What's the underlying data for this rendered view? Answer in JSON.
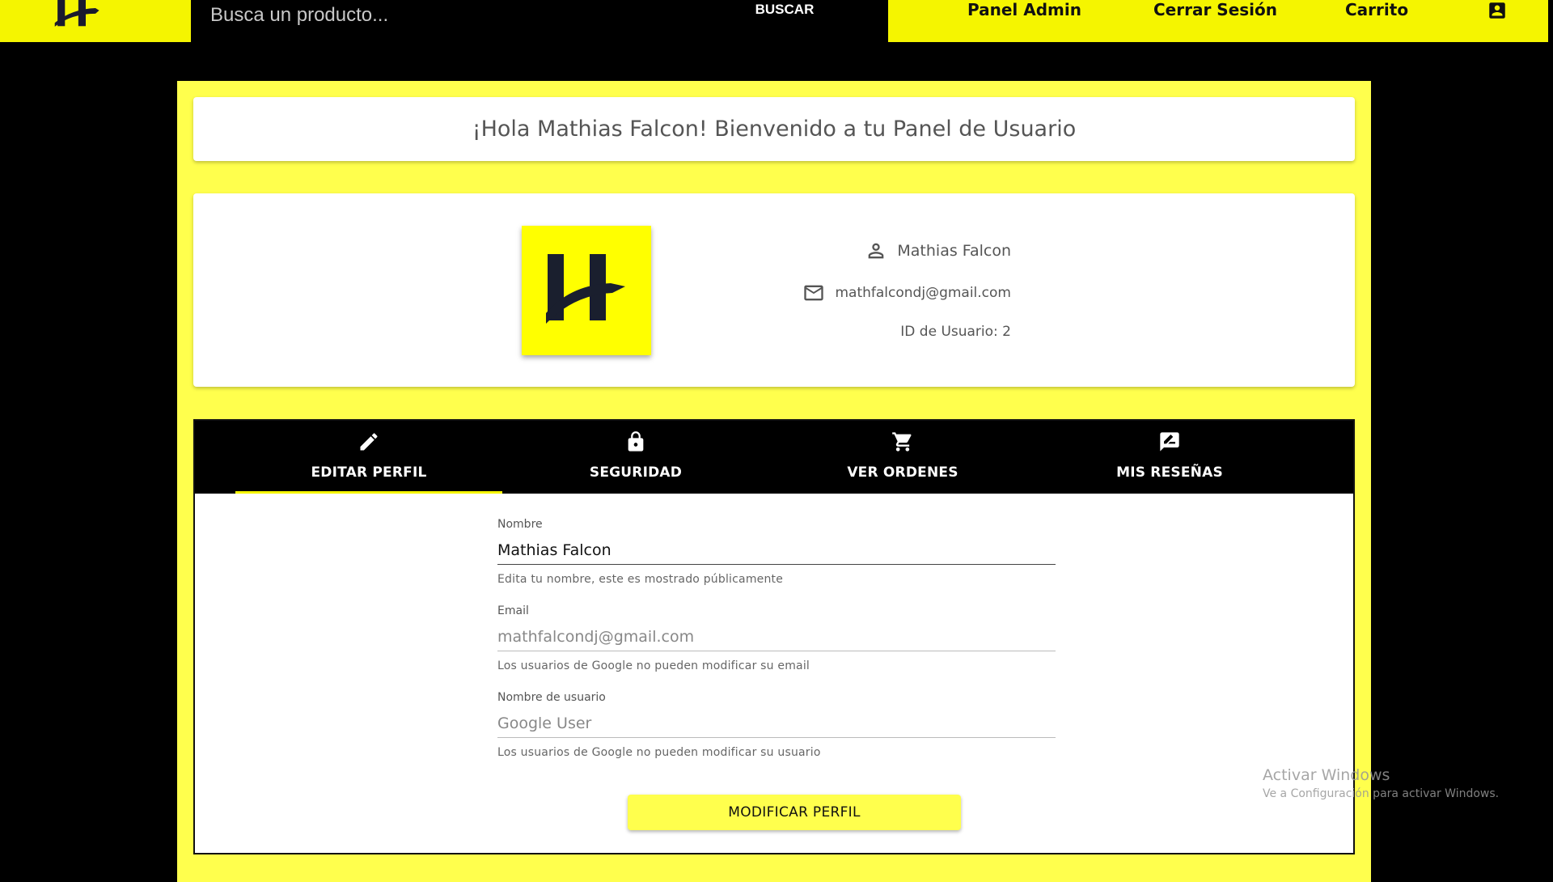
{
  "header": {
    "search_placeholder": "Busca un producto...",
    "search_button": "BUSCAR",
    "nav": {
      "admin": "Panel Admin",
      "logout": "Cerrar Sesión",
      "cart": "Carrito"
    }
  },
  "welcome": {
    "title": "¡Hola Mathias Falcon! Bienvenido a tu Panel de Usuario"
  },
  "profile": {
    "name": "Mathias Falcon",
    "email": "mathfalcondj@gmail.com",
    "user_id_text": "ID de Usuario: 2"
  },
  "tabs": [
    {
      "label": "EDITAR PERFIL",
      "icon": "pencil-icon",
      "active": true
    },
    {
      "label": "SEGURIDAD",
      "icon": "lock-icon",
      "active": false
    },
    {
      "label": "VER ORDENES",
      "icon": "cart-icon",
      "active": false
    },
    {
      "label": "MIS RESEÑAS",
      "icon": "review-icon",
      "active": false
    }
  ],
  "form": {
    "fields": [
      {
        "label": "Nombre",
        "value": "Mathias Falcon",
        "help": "Edita tu nombre, este es mostrado públicamente",
        "disabled": false
      },
      {
        "label": "Email",
        "value": "mathfalcondj@gmail.com",
        "help": "Los usuarios de Google no pueden modificar su email",
        "disabled": true
      },
      {
        "label": "Nombre de usuario",
        "value": "Google User",
        "help": "Los usuarios de Google no pueden modificar su usuario",
        "disabled": true
      }
    ],
    "submit_label": "MODIFICAR PERFIL"
  },
  "watermark": {
    "title": "Activar Windows",
    "subtitle": "Ve a Configuración para activar Windows."
  },
  "colors": {
    "brand_yellow": "#f5f500",
    "panel_yellow": "#ffff4d",
    "background": "#000000"
  }
}
